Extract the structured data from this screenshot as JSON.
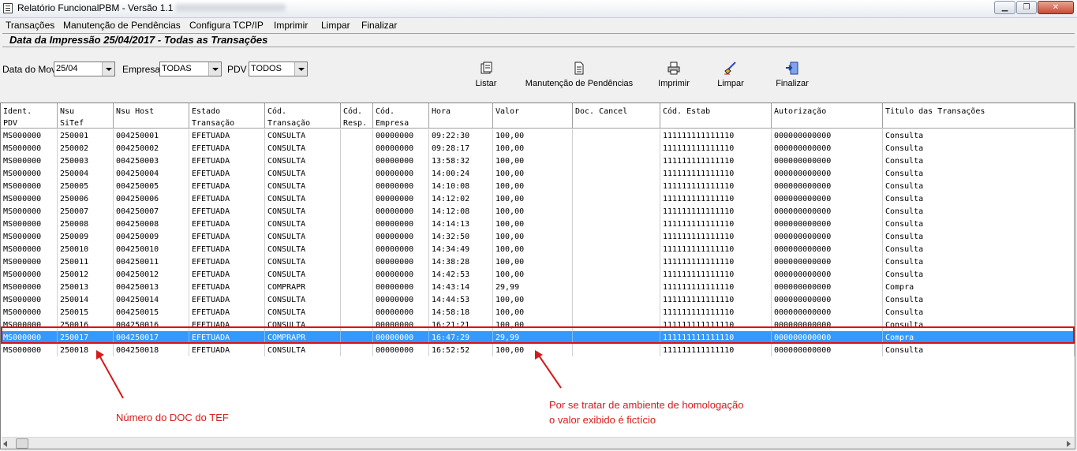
{
  "window": {
    "title": "Relatório FuncionalPBM - Versão 1.1",
    "controls": {
      "minimize": "▁",
      "maximize": "❐",
      "close": "✕"
    }
  },
  "menu": [
    "Transações",
    "Manutenção de Pendências",
    "Configura TCP/IP",
    "Imprimir",
    "Limpar",
    "Finalizar"
  ],
  "header": {
    "title": "Data da Impressão 25/04/2017 - Todas as Transações"
  },
  "filters": {
    "data_mov_label": "Data do Mov.",
    "data_mov_value": "25/04",
    "empresa_label": "Empresa",
    "empresa_value": "TODAS",
    "pdv_label": "PDV",
    "pdv_value": "TODOS"
  },
  "toolbar": {
    "listar": "Listar",
    "manutencao": "Manutenção de Pendências",
    "imprimir": "Imprimir",
    "limpar": "Limpar",
    "finalizar": "Finalizar"
  },
  "grid": {
    "columns": [
      "Ident.\nPDV",
      "Nsu\nSiTef",
      "Nsu Host",
      "Estado\nTransação",
      "Cód.\nTransação",
      "Cód.\nResp.",
      "Cód.\nEmpresa",
      "Hora",
      "Valor",
      "Doc. Cancel",
      "Cód. Estab",
      "Autorização",
      "Titulo das Transações"
    ],
    "rows": [
      [
        "MS000000",
        "250001",
        "004250001",
        "EFETUADA",
        "CONSULTA",
        "",
        "00000000",
        "09:22:30",
        "100,00",
        "",
        "111111111111110",
        "000000000000",
        "Consulta"
      ],
      [
        "MS000000",
        "250002",
        "004250002",
        "EFETUADA",
        "CONSULTA",
        "",
        "00000000",
        "09:28:17",
        "100,00",
        "",
        "111111111111110",
        "000000000000",
        "Consulta"
      ],
      [
        "MS000000",
        "250003",
        "004250003",
        "EFETUADA",
        "CONSULTA",
        "",
        "00000000",
        "13:58:32",
        "100,00",
        "",
        "111111111111110",
        "000000000000",
        "Consulta"
      ],
      [
        "MS000000",
        "250004",
        "004250004",
        "EFETUADA",
        "CONSULTA",
        "",
        "00000000",
        "14:00:24",
        "100,00",
        "",
        "111111111111110",
        "000000000000",
        "Consulta"
      ],
      [
        "MS000000",
        "250005",
        "004250005",
        "EFETUADA",
        "CONSULTA",
        "",
        "00000000",
        "14:10:08",
        "100,00",
        "",
        "111111111111110",
        "000000000000",
        "Consulta"
      ],
      [
        "MS000000",
        "250006",
        "004250006",
        "EFETUADA",
        "CONSULTA",
        "",
        "00000000",
        "14:12:02",
        "100,00",
        "",
        "111111111111110",
        "000000000000",
        "Consulta"
      ],
      [
        "MS000000",
        "250007",
        "004250007",
        "EFETUADA",
        "CONSULTA",
        "",
        "00000000",
        "14:12:08",
        "100,00",
        "",
        "111111111111110",
        "000000000000",
        "Consulta"
      ],
      [
        "MS000000",
        "250008",
        "004250008",
        "EFETUADA",
        "CONSULTA",
        "",
        "00000000",
        "14:14:13",
        "100,00",
        "",
        "111111111111110",
        "000000000000",
        "Consulta"
      ],
      [
        "MS000000",
        "250009",
        "004250009",
        "EFETUADA",
        "CONSULTA",
        "",
        "00000000",
        "14:32:50",
        "100,00",
        "",
        "111111111111110",
        "000000000000",
        "Consulta"
      ],
      [
        "MS000000",
        "250010",
        "004250010",
        "EFETUADA",
        "CONSULTA",
        "",
        "00000000",
        "14:34:49",
        "100,00",
        "",
        "111111111111110",
        "000000000000",
        "Consulta"
      ],
      [
        "MS000000",
        "250011",
        "004250011",
        "EFETUADA",
        "CONSULTA",
        "",
        "00000000",
        "14:38:28",
        "100,00",
        "",
        "111111111111110",
        "000000000000",
        "Consulta"
      ],
      [
        "MS000000",
        "250012",
        "004250012",
        "EFETUADA",
        "CONSULTA",
        "",
        "00000000",
        "14:42:53",
        "100,00",
        "",
        "111111111111110",
        "000000000000",
        "Consulta"
      ],
      [
        "MS000000",
        "250013",
        "004250013",
        "EFETUADA",
        "COMPRAPR",
        "",
        "00000000",
        "14:43:14",
        "29,99",
        "",
        "111111111111110",
        "000000000000",
        "Compra"
      ],
      [
        "MS000000",
        "250014",
        "004250014",
        "EFETUADA",
        "CONSULTA",
        "",
        "00000000",
        "14:44:53",
        "100,00",
        "",
        "111111111111110",
        "000000000000",
        "Consulta"
      ],
      [
        "MS000000",
        "250015",
        "004250015",
        "EFETUADA",
        "CONSULTA",
        "",
        "00000000",
        "14:58:18",
        "100,00",
        "",
        "111111111111110",
        "000000000000",
        "Consulta"
      ],
      [
        "MS000000",
        "250016",
        "004250016",
        "EFETUADA",
        "CONSULTA",
        "",
        "00000000",
        "16:21:21",
        "100,00",
        "",
        "111111111111110",
        "000000000000",
        "Consulta"
      ],
      [
        "MS000000",
        "250017",
        "004250017",
        "EFETUADA",
        "COMPRAPR",
        "",
        "00000000",
        "16:47:29",
        "29,99",
        "",
        "111111111111110",
        "000000000000",
        "Compra"
      ],
      [
        "MS000000",
        "250018",
        "004250018",
        "EFETUADA",
        "CONSULTA",
        "",
        "00000000",
        "16:52:52",
        "100,00",
        "",
        "111111111111110",
        "000000000000",
        "Consulta"
      ]
    ],
    "selected_row": 16
  },
  "annotations": {
    "doc_tef": "Número do DOC do TEF",
    "valor_line1": "Por se tratar de ambiente de homologação",
    "valor_line2": "o valor exibido é fictício",
    "color": "#d41b1b"
  },
  "colors": {
    "selection": "#3399ff",
    "highlight_box": "#e01010"
  }
}
